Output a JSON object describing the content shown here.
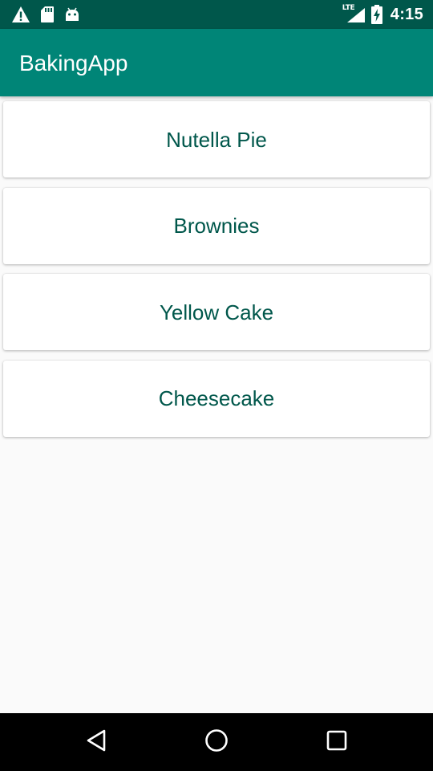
{
  "status_bar": {
    "icons_left": [
      "warning-icon",
      "sd-card-icon",
      "android-icon"
    ],
    "icons_right": [
      "lte-signal-icon",
      "battery-charging-icon"
    ],
    "network": "LTE",
    "time": "4:15"
  },
  "toolbar": {
    "title": "BakingApp"
  },
  "recipes": [
    {
      "name": "Nutella Pie"
    },
    {
      "name": "Brownies"
    },
    {
      "name": "Yellow Cake"
    },
    {
      "name": "Cheesecake"
    }
  ],
  "nav_bar": {
    "buttons": [
      "back-icon",
      "home-icon",
      "recents-icon"
    ]
  },
  "colors": {
    "status_bar": "#00574b",
    "toolbar": "#008577",
    "recipe_text": "#00574b",
    "background": "#fafafa"
  }
}
